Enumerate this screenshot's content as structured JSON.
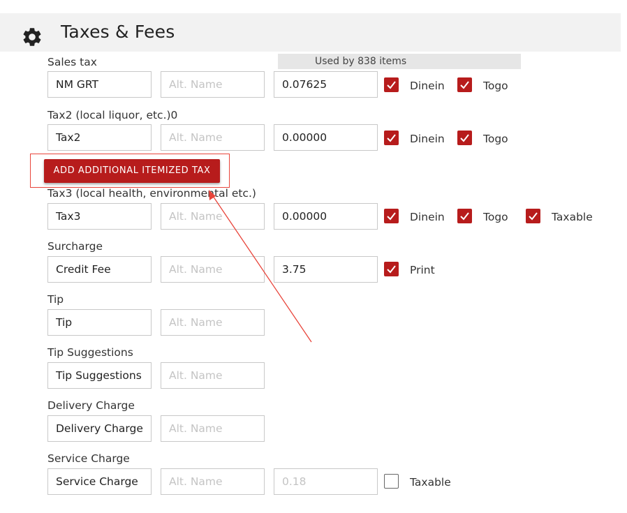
{
  "header": {
    "title": "Taxes & Fees",
    "icon": "gear-icon"
  },
  "accent_color": "#b71c1c",
  "used_by": "Used by 838 items",
  "add_button_label": "ADD ADDITIONAL ITEMIZED TAX",
  "rows": {
    "sales_tax": {
      "label": "Sales tax",
      "name": "NM GRT",
      "alt_placeholder": "Alt. Name",
      "value": "0.07625",
      "dinein": {
        "label": "Dinein",
        "checked": true
      },
      "togo": {
        "label": "Togo",
        "checked": true
      }
    },
    "tax2": {
      "label": "Tax2 (local liquor, etc.)0",
      "name": "Tax2",
      "alt_placeholder": "Alt. Name",
      "value": "0.00000",
      "dinein": {
        "label": "Dinein",
        "checked": true
      },
      "togo": {
        "label": "Togo",
        "checked": true
      }
    },
    "tax3": {
      "label": "Tax3 (local health, environmental etc.)",
      "name": "Tax3",
      "alt_placeholder": "Alt. Name",
      "value": "0.00000",
      "dinein": {
        "label": "Dinein",
        "checked": true
      },
      "togo": {
        "label": "Togo",
        "checked": true
      },
      "taxable": {
        "label": "Taxable",
        "checked": true
      }
    },
    "surcharge": {
      "label": "Surcharge",
      "name": "Credit Fee",
      "alt_placeholder": "Alt. Name",
      "value": "3.75",
      "print": {
        "label": "Print",
        "checked": true
      }
    },
    "tip": {
      "label": "Tip",
      "name": "Tip",
      "alt_placeholder": "Alt. Name"
    },
    "tip_suggestions": {
      "label": "Tip Suggestions",
      "name": "Tip Suggestions",
      "alt_placeholder": "Alt. Name"
    },
    "delivery_charge": {
      "label": "Delivery Charge",
      "name": "Delivery Charge",
      "alt_placeholder": "Alt. Name"
    },
    "service_charge": {
      "label": "Service Charge",
      "name": "Service Charge",
      "alt_placeholder": "Alt. Name",
      "value_placeholder": "0.18",
      "taxable": {
        "label": "Taxable",
        "checked": false
      }
    }
  }
}
